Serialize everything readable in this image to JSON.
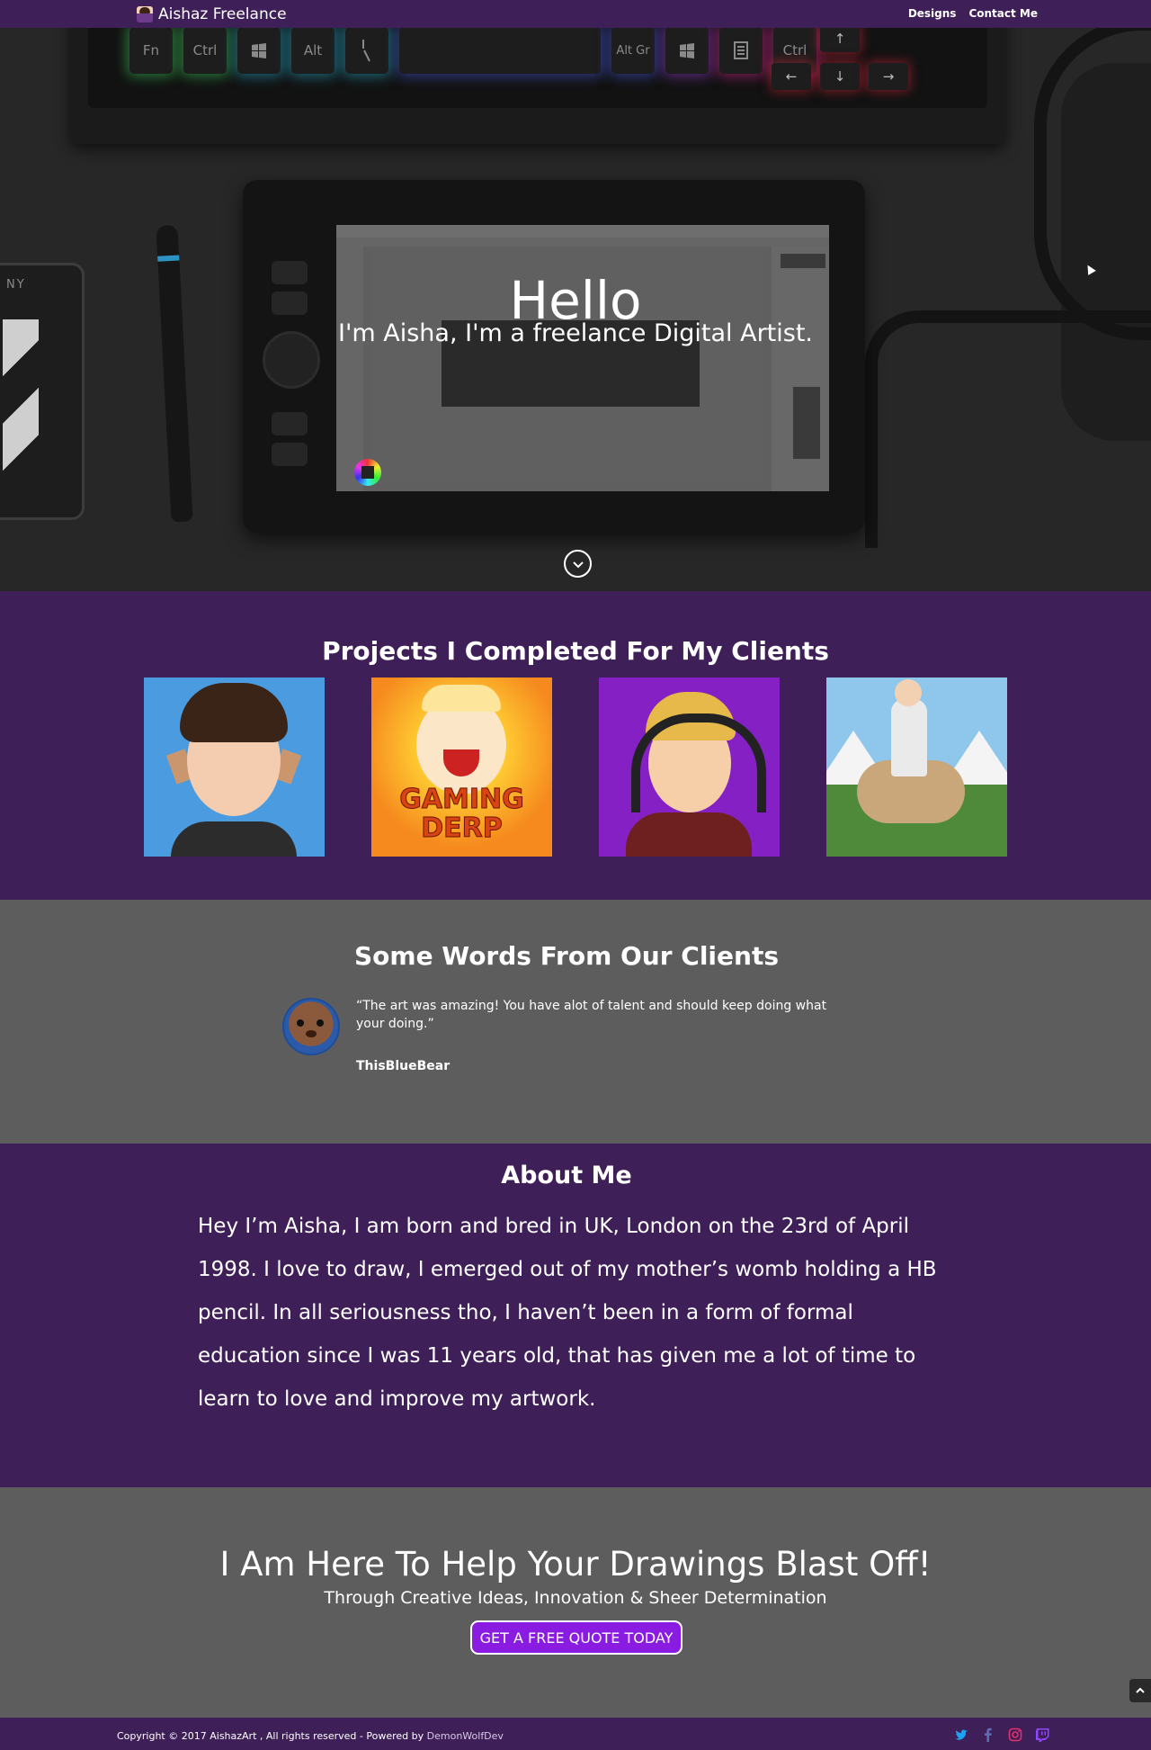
{
  "header": {
    "brand": "Aishaz Freelance",
    "nav": [
      "Designs",
      "Contact Me"
    ]
  },
  "hero": {
    "keyboard_keys": [
      "Fn",
      "Ctrl",
      "Alt",
      "Alt Gr",
      "Ctrl"
    ],
    "phone_logo": "NY",
    "title": "Hello",
    "subtitle": "I'm Aisha, I'm a freelance Digital Artist."
  },
  "projects": {
    "title": "Projects I Completed For My Clients",
    "items": [
      {
        "art_text": ""
      },
      {
        "art_text": "GAMING\nDERP"
      },
      {
        "art_text": ""
      },
      {
        "art_text": ""
      }
    ]
  },
  "testimonials": {
    "title": "Some Words From Our Clients",
    "quote": "“The art was amazing! You have alot of talent and should keep doing what your doing.”",
    "author": "ThisBlueBear"
  },
  "about": {
    "title": "About Me",
    "text": "Hey I’m Aisha, I am born and bred in UK, London on the 23rd of April 1998. I love to draw, I emerged out of my mother’s womb holding a HB pencil. In all seriousness tho, I haven’t been in a form of formal education since I was 11 years old, that has given me a lot of time to learn to love and improve my artwork."
  },
  "cta": {
    "title": "I Am Here To Help Your Drawings Blast Off!",
    "subtitle": "Through Creative Ideas, Innovation & Sheer Determination",
    "button": "GET A FREE QUOTE TODAY"
  },
  "footer": {
    "copyright": "Copyright © 2017 AishazArt , All rights reserved - Powered by ",
    "powered_by": "DemonWolfDev",
    "social_icons": [
      "twitter-icon",
      "facebook-icon",
      "instagram-icon",
      "twitch-icon"
    ]
  },
  "colors": {
    "purple": "#3f1f57",
    "gray": "#5d5d5d",
    "accent": "#8a1be0",
    "twitter": "#1da1f2",
    "facebook": "#3b5998",
    "instagram": "#e1306c",
    "twitch": "#9146ff"
  }
}
